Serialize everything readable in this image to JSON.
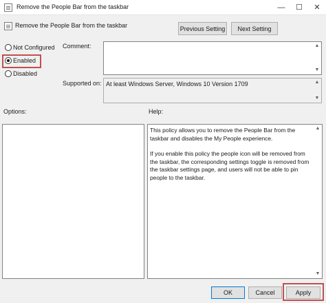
{
  "window": {
    "title": "Remove the People Bar from the taskbar",
    "minimize": "—",
    "maximize": "☐",
    "close": "✕"
  },
  "header": {
    "setting_name": "Remove the People Bar from the taskbar",
    "previous_setting": "Previous Setting",
    "next_setting": "Next Setting"
  },
  "state": {
    "options": [
      "Not Configured",
      "Enabled",
      "Disabled"
    ],
    "selected": "Enabled"
  },
  "comment": {
    "label": "Comment:",
    "value": ""
  },
  "supported": {
    "label": "Supported on:",
    "value": "At least Windows Server, Windows 10 Version 1709"
  },
  "options_panel": {
    "label": "Options:"
  },
  "help_panel": {
    "label": "Help:",
    "paragraphs": [
      "This policy allows you to remove the People Bar from the taskbar and disables the My People experience.",
      "If you enable this policy the people icon will be removed from the taskbar, the corresponding settings toggle is removed from the taskbar settings page, and users will not be able to pin people to the taskbar."
    ]
  },
  "footer": {
    "ok": "OK",
    "cancel": "Cancel",
    "apply": "Apply"
  },
  "colors": {
    "highlight": "#c0504d",
    "window_bg": "#f0f0f0"
  }
}
